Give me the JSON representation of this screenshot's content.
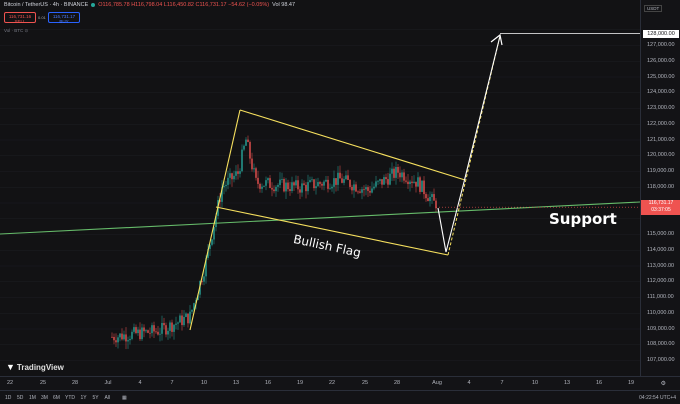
{
  "header": {
    "symbol": "Bitcoin / TetherUS · 4h · BINANCE",
    "ohlc": "O116,785.78 H116,798.04 L116,450.82 C116,731.17 −54.62 (−0.05%)",
    "volume": "Vol 98.47",
    "sell_price": "116,731.16",
    "sell_label": "SELL",
    "spread": "0.01",
    "buy_price": "116,731.17",
    "buy_label": "BUY",
    "indicator_row": "Vol · BTC  ⊙"
  },
  "currency": "USDT",
  "y_axis": {
    "ticks": [
      "127,000.00",
      "126,000.00",
      "125,000.00",
      "124,000.00",
      "123,000.00",
      "122,000.00",
      "121,000.00",
      "120,000.00",
      "119,000.00",
      "118,000.00",
      "117,000.00",
      "115,000.00",
      "114,000.00",
      "113,000.00",
      "112,000.00",
      "111,000.00",
      "110,000.00",
      "109,000.00",
      "108,000.00",
      "107,000.00"
    ],
    "target_label": "128,000.00",
    "current_price": "116,731.17",
    "countdown": "03:37:05"
  },
  "x_axis": {
    "ticks": [
      "22",
      "25",
      "28",
      "Jul",
      "4",
      "7",
      "10",
      "13",
      "16",
      "19",
      "22",
      "25",
      "28",
      "Aug",
      "4",
      "7",
      "10",
      "13",
      "16",
      "19"
    ]
  },
  "annotations": {
    "support": "Support",
    "flag": "Bullish Flag"
  },
  "logo": "TradingView",
  "toolbar": {
    "timeframes": [
      "1D",
      "5D",
      "1M",
      "3M",
      "6M",
      "YTD",
      "1Y",
      "5Y",
      "All"
    ],
    "clock": "04:22:54 UTC+4"
  },
  "colors": {
    "up": "#26a69a",
    "down": "#ef5350",
    "flag": "#f6e05e",
    "support": "#66bb6a",
    "target": "#ffffff"
  }
}
